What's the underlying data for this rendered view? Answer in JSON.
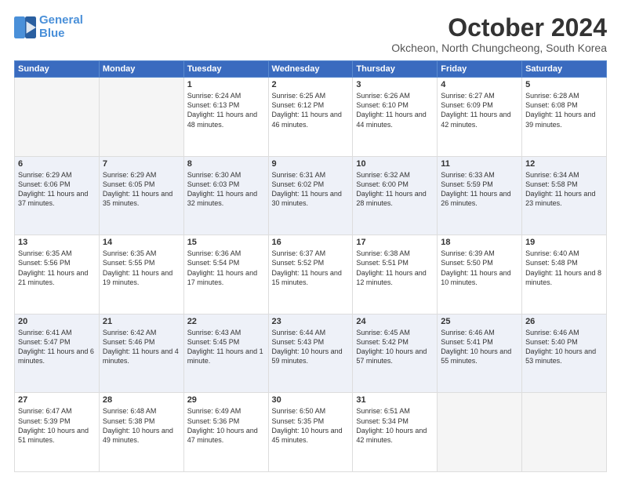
{
  "logo": {
    "line1": "General",
    "line2": "Blue"
  },
  "title": "October 2024",
  "subtitle": "Okcheon, North Chungcheong, South Korea",
  "days_of_week": [
    "Sunday",
    "Monday",
    "Tuesday",
    "Wednesday",
    "Thursday",
    "Friday",
    "Saturday"
  ],
  "weeks": [
    [
      {
        "num": "",
        "sunrise": "",
        "sunset": "",
        "daylight": "",
        "empty": true
      },
      {
        "num": "",
        "sunrise": "",
        "sunset": "",
        "daylight": "",
        "empty": true
      },
      {
        "num": "1",
        "sunrise": "Sunrise: 6:24 AM",
        "sunset": "Sunset: 6:13 PM",
        "daylight": "Daylight: 11 hours and 48 minutes."
      },
      {
        "num": "2",
        "sunrise": "Sunrise: 6:25 AM",
        "sunset": "Sunset: 6:12 PM",
        "daylight": "Daylight: 11 hours and 46 minutes."
      },
      {
        "num": "3",
        "sunrise": "Sunrise: 6:26 AM",
        "sunset": "Sunset: 6:10 PM",
        "daylight": "Daylight: 11 hours and 44 minutes."
      },
      {
        "num": "4",
        "sunrise": "Sunrise: 6:27 AM",
        "sunset": "Sunset: 6:09 PM",
        "daylight": "Daylight: 11 hours and 42 minutes."
      },
      {
        "num": "5",
        "sunrise": "Sunrise: 6:28 AM",
        "sunset": "Sunset: 6:08 PM",
        "daylight": "Daylight: 11 hours and 39 minutes."
      }
    ],
    [
      {
        "num": "6",
        "sunrise": "Sunrise: 6:29 AM",
        "sunset": "Sunset: 6:06 PM",
        "daylight": "Daylight: 11 hours and 37 minutes."
      },
      {
        "num": "7",
        "sunrise": "Sunrise: 6:29 AM",
        "sunset": "Sunset: 6:05 PM",
        "daylight": "Daylight: 11 hours and 35 minutes."
      },
      {
        "num": "8",
        "sunrise": "Sunrise: 6:30 AM",
        "sunset": "Sunset: 6:03 PM",
        "daylight": "Daylight: 11 hours and 32 minutes."
      },
      {
        "num": "9",
        "sunrise": "Sunrise: 6:31 AM",
        "sunset": "Sunset: 6:02 PM",
        "daylight": "Daylight: 11 hours and 30 minutes."
      },
      {
        "num": "10",
        "sunrise": "Sunrise: 6:32 AM",
        "sunset": "Sunset: 6:00 PM",
        "daylight": "Daylight: 11 hours and 28 minutes."
      },
      {
        "num": "11",
        "sunrise": "Sunrise: 6:33 AM",
        "sunset": "Sunset: 5:59 PM",
        "daylight": "Daylight: 11 hours and 26 minutes."
      },
      {
        "num": "12",
        "sunrise": "Sunrise: 6:34 AM",
        "sunset": "Sunset: 5:58 PM",
        "daylight": "Daylight: 11 hours and 23 minutes."
      }
    ],
    [
      {
        "num": "13",
        "sunrise": "Sunrise: 6:35 AM",
        "sunset": "Sunset: 5:56 PM",
        "daylight": "Daylight: 11 hours and 21 minutes."
      },
      {
        "num": "14",
        "sunrise": "Sunrise: 6:35 AM",
        "sunset": "Sunset: 5:55 PM",
        "daylight": "Daylight: 11 hours and 19 minutes."
      },
      {
        "num": "15",
        "sunrise": "Sunrise: 6:36 AM",
        "sunset": "Sunset: 5:54 PM",
        "daylight": "Daylight: 11 hours and 17 minutes."
      },
      {
        "num": "16",
        "sunrise": "Sunrise: 6:37 AM",
        "sunset": "Sunset: 5:52 PM",
        "daylight": "Daylight: 11 hours and 15 minutes."
      },
      {
        "num": "17",
        "sunrise": "Sunrise: 6:38 AM",
        "sunset": "Sunset: 5:51 PM",
        "daylight": "Daylight: 11 hours and 12 minutes."
      },
      {
        "num": "18",
        "sunrise": "Sunrise: 6:39 AM",
        "sunset": "Sunset: 5:50 PM",
        "daylight": "Daylight: 11 hours and 10 minutes."
      },
      {
        "num": "19",
        "sunrise": "Sunrise: 6:40 AM",
        "sunset": "Sunset: 5:48 PM",
        "daylight": "Daylight: 11 hours and 8 minutes."
      }
    ],
    [
      {
        "num": "20",
        "sunrise": "Sunrise: 6:41 AM",
        "sunset": "Sunset: 5:47 PM",
        "daylight": "Daylight: 11 hours and 6 minutes."
      },
      {
        "num": "21",
        "sunrise": "Sunrise: 6:42 AM",
        "sunset": "Sunset: 5:46 PM",
        "daylight": "Daylight: 11 hours and 4 minutes."
      },
      {
        "num": "22",
        "sunrise": "Sunrise: 6:43 AM",
        "sunset": "Sunset: 5:45 PM",
        "daylight": "Daylight: 11 hours and 1 minute."
      },
      {
        "num": "23",
        "sunrise": "Sunrise: 6:44 AM",
        "sunset": "Sunset: 5:43 PM",
        "daylight": "Daylight: 10 hours and 59 minutes."
      },
      {
        "num": "24",
        "sunrise": "Sunrise: 6:45 AM",
        "sunset": "Sunset: 5:42 PM",
        "daylight": "Daylight: 10 hours and 57 minutes."
      },
      {
        "num": "25",
        "sunrise": "Sunrise: 6:46 AM",
        "sunset": "Sunset: 5:41 PM",
        "daylight": "Daylight: 10 hours and 55 minutes."
      },
      {
        "num": "26",
        "sunrise": "Sunrise: 6:46 AM",
        "sunset": "Sunset: 5:40 PM",
        "daylight": "Daylight: 10 hours and 53 minutes."
      }
    ],
    [
      {
        "num": "27",
        "sunrise": "Sunrise: 6:47 AM",
        "sunset": "Sunset: 5:39 PM",
        "daylight": "Daylight: 10 hours and 51 minutes."
      },
      {
        "num": "28",
        "sunrise": "Sunrise: 6:48 AM",
        "sunset": "Sunset: 5:38 PM",
        "daylight": "Daylight: 10 hours and 49 minutes."
      },
      {
        "num": "29",
        "sunrise": "Sunrise: 6:49 AM",
        "sunset": "Sunset: 5:36 PM",
        "daylight": "Daylight: 10 hours and 47 minutes."
      },
      {
        "num": "30",
        "sunrise": "Sunrise: 6:50 AM",
        "sunset": "Sunset: 5:35 PM",
        "daylight": "Daylight: 10 hours and 45 minutes."
      },
      {
        "num": "31",
        "sunrise": "Sunrise: 6:51 AM",
        "sunset": "Sunset: 5:34 PM",
        "daylight": "Daylight: 10 hours and 42 minutes."
      },
      {
        "num": "",
        "sunrise": "",
        "sunset": "",
        "daylight": "",
        "empty": true
      },
      {
        "num": "",
        "sunrise": "",
        "sunset": "",
        "daylight": "",
        "empty": true
      }
    ]
  ]
}
